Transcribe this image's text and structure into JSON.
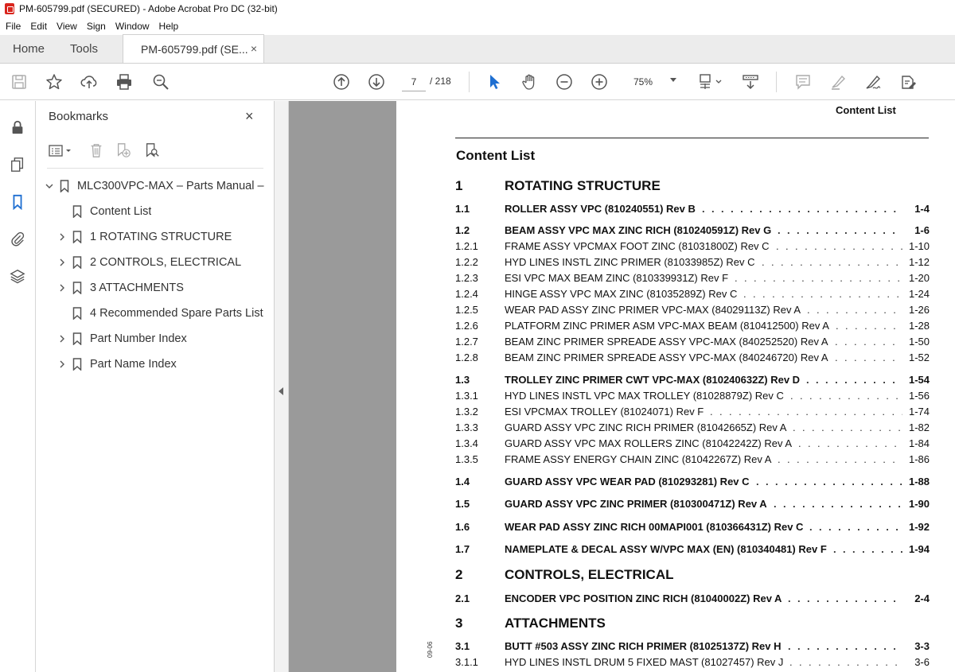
{
  "window": {
    "title": "PM-605799.pdf (SECURED) - Adobe Acrobat Pro DC (32-bit)"
  },
  "menu": [
    "File",
    "Edit",
    "View",
    "Sign",
    "Window",
    "Help"
  ],
  "tabs": {
    "home": "Home",
    "tools": "Tools",
    "document": "PM-605799.pdf (SE...",
    "close": "×"
  },
  "toolbar": {
    "page_current": "7",
    "page_total": "/ 218",
    "zoom": "75%"
  },
  "bookmarks": {
    "header": "Bookmarks",
    "close": "×",
    "items": [
      {
        "label": "MLC300VPC-MAX – Parts Manual –",
        "expanded": true,
        "has_children": true,
        "level": 0
      },
      {
        "label": "Content List",
        "has_children": false,
        "level": 1
      },
      {
        "label": "1 ROTATING STRUCTURE",
        "has_children": true,
        "level": 1
      },
      {
        "label": "2 CONTROLS, ELECTRICAL",
        "has_children": true,
        "level": 1
      },
      {
        "label": "3 ATTACHMENTS",
        "has_children": true,
        "level": 1
      },
      {
        "label": "4 Recommended Spare Parts List",
        "has_children": false,
        "level": 1
      },
      {
        "label": "Part Number Index",
        "has_children": true,
        "level": 1
      },
      {
        "label": "Part Name Index",
        "has_children": true,
        "level": 1
      }
    ]
  },
  "document": {
    "running_head": "Content List",
    "title": "Content List",
    "side_date": "09-06",
    "toc": [
      {
        "num": "1",
        "text": "ROTATING STRUCTURE",
        "page": "",
        "style": "chapter"
      },
      {
        "num": "1.1",
        "text": "ROLLER ASSY VPC (810240551) Rev B",
        "page": "1-4",
        "style": "bold"
      },
      {
        "num": "1.2",
        "text": "BEAM ASSY VPC MAX ZINC RICH (810240591Z) Rev G",
        "page": "1-6",
        "style": "bold"
      },
      {
        "num": "1.2.1",
        "text": "FRAME ASSY VPCMAX FOOT ZINC (81031800Z) Rev C",
        "page": "1-10",
        "style": "normal"
      },
      {
        "num": "1.2.2",
        "text": "HYD LINES INSTL ZINC PRIMER (81033985Z) Rev C",
        "page": "1-12",
        "style": "normal"
      },
      {
        "num": "1.2.3",
        "text": "ESI VPC MAX BEAM ZINC (810339931Z) Rev F",
        "page": "1-20",
        "style": "normal"
      },
      {
        "num": "1.2.4",
        "text": "HINGE ASSY VPC MAX ZINC (81035289Z) Rev C",
        "page": "1-24",
        "style": "normal"
      },
      {
        "num": "1.2.5",
        "text": "WEAR PAD ASSY ZINC PRIMER VPC-MAX (84029113Z) Rev A",
        "page": "1-26",
        "style": "normal"
      },
      {
        "num": "1.2.6",
        "text": "PLATFORM ZINC PRIMER ASM VPC-MAX BEAM (810412500) Rev A",
        "page": "1-28",
        "style": "normal"
      },
      {
        "num": "1.2.7",
        "text": "BEAM ZINC PRIMER SPREADE ASSY VPC-MAX (840252520) Rev A",
        "page": "1-50",
        "style": "normal"
      },
      {
        "num": "1.2.8",
        "text": "BEAM ZINC PRIMER SPREADE ASSY VPC-MAX (840246720) Rev A",
        "page": "1-52",
        "style": "normal"
      },
      {
        "num": "1.3",
        "text": "TROLLEY ZINC PRIMER CWT VPC-MAX (810240632Z) Rev D",
        "page": "1-54",
        "style": "bold"
      },
      {
        "num": "1.3.1",
        "text": "HYD LINES INSTL VPC MAX TROLLEY (81028879Z) Rev C",
        "page": "1-56",
        "style": "normal"
      },
      {
        "num": "1.3.2",
        "text": "ESI VPCMAX TROLLEY (81024071) Rev F",
        "page": "1-74",
        "style": "normal"
      },
      {
        "num": "1.3.3",
        "text": "GUARD ASSY VPC ZINC RICH PRIMER (81042665Z) Rev A",
        "page": "1-82",
        "style": "normal"
      },
      {
        "num": "1.3.4",
        "text": "GUARD ASSY VPC MAX ROLLERS ZINC (81042242Z) Rev A",
        "page": "1-84",
        "style": "normal"
      },
      {
        "num": "1.3.5",
        "text": "FRAME ASSY ENERGY CHAIN ZINC (81042267Z) Rev A",
        "page": "1-86",
        "style": "normal"
      },
      {
        "num": "1.4",
        "text": "GUARD ASSY VPC WEAR PAD (810293281) Rev C",
        "page": "1-88",
        "style": "bold"
      },
      {
        "num": "1.5",
        "text": "GUARD ASSY VPC ZINC PRIMER (810300471Z) Rev A",
        "page": "1-90",
        "style": "bold"
      },
      {
        "num": "1.6",
        "text": "WEAR PAD ASSY ZINC RICH 00MAPI001 (810366431Z) Rev C",
        "page": "1-92",
        "style": "bold"
      },
      {
        "num": "1.7",
        "text": "NAMEPLATE & DECAL ASSY W/VPC MAX (EN) (810340481) Rev F",
        "page": "1-94",
        "style": "bold"
      },
      {
        "num": "2",
        "text": "CONTROLS, ELECTRICAL",
        "page": "",
        "style": "chapter"
      },
      {
        "num": "2.1",
        "text": "ENCODER VPC POSITION ZINC RICH (81040002Z) Rev A",
        "page": "2-4",
        "style": "bold"
      },
      {
        "num": "3",
        "text": "ATTACHMENTS",
        "page": "",
        "style": "chapter"
      },
      {
        "num": "3.1",
        "text": "BUTT #503 ASSY ZINC RICH PRIMER (81025137Z) Rev H",
        "page": "3-3",
        "style": "bold"
      },
      {
        "num": "3.1.1",
        "text": "HYD LINES INSTL DRUM 5 FIXED MAST (81027457) Rev J",
        "page": "3-6",
        "style": "normal"
      }
    ]
  },
  "colors": {
    "accent": "#1f6fd1",
    "pdf_red": "#d9251d",
    "doc_bg": "#9a9a9a",
    "tab_bg": "#ececec"
  }
}
